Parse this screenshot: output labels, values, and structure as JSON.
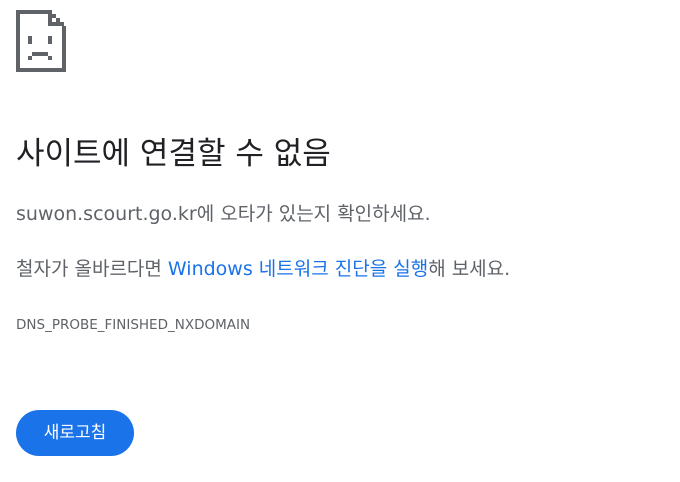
{
  "page": {
    "icon": "sad-document-icon",
    "title": "사이트에 연결할 수 없음",
    "message1": {
      "host": "suwon.scourt.go.kr",
      "suffix": "에 오타가 있는지 확인하세요."
    },
    "message2": {
      "prefix": "철자가 올바르다면 ",
      "link": "Windows 네트워크 진단을 실행",
      "suffix": "해 보세요."
    },
    "error_code": "DNS_PROBE_FINISHED_NXDOMAIN",
    "reload_label": "새로고침"
  },
  "colors": {
    "accent": "#1a73e8",
    "title": "#202124",
    "body_text": "#5f6368",
    "background": "#ffffff"
  }
}
